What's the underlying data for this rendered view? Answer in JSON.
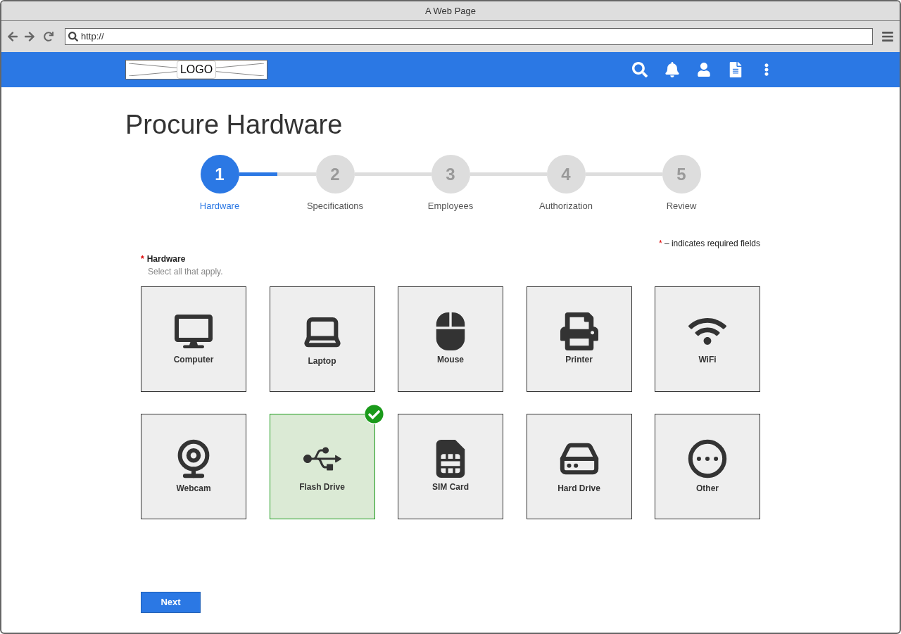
{
  "window": {
    "title": "A Web Page"
  },
  "address_bar": {
    "value": "http://"
  },
  "navbar": {
    "logo": "LOGO"
  },
  "page_title": "Procure Hardware",
  "stepper": {
    "steps": [
      {
        "number": "1",
        "label": "Hardware",
        "selected": true
      },
      {
        "number": "2",
        "label": "Specifications",
        "selected": false
      },
      {
        "number": "3",
        "label": "Employees",
        "selected": false
      },
      {
        "number": "4",
        "label": "Authorization",
        "selected": false
      },
      {
        "number": "5",
        "label": "Review",
        "selected": false
      }
    ]
  },
  "required_note": {
    "mark": "*",
    "text": "– indicates required fields"
  },
  "field": {
    "mark": "*",
    "label": "Hardware",
    "hint": "Select all that apply."
  },
  "tiles": [
    {
      "kind": "computer",
      "label": "Computer",
      "selected": false
    },
    {
      "kind": "laptop",
      "label": "Laptop",
      "selected": false
    },
    {
      "kind": "mouse",
      "label": "Mouse",
      "selected": false
    },
    {
      "kind": "printer",
      "label": "Printer",
      "selected": false
    },
    {
      "kind": "wifi",
      "label": "WiFi",
      "selected": false
    },
    {
      "kind": "webcam",
      "label": "Webcam",
      "selected": false
    },
    {
      "kind": "usb",
      "label": "Flash Drive",
      "selected": true
    },
    {
      "kind": "sim",
      "label": "SIM Card",
      "selected": false
    },
    {
      "kind": "harddrive",
      "label": "Hard Drive",
      "selected": false
    },
    {
      "kind": "other",
      "label": "Other",
      "selected": false
    }
  ],
  "next_button": "Next"
}
